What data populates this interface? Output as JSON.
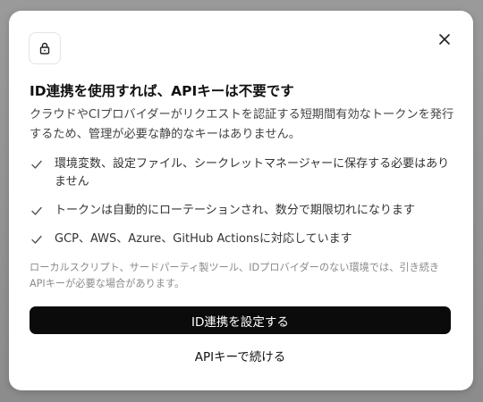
{
  "dialog": {
    "title": "ID連携を使用すれば、APIキーは不要です",
    "description": "クラウドやCIプロバイダーがリクエストを認証する短期間有効なトークンを発行するため、管理が必要な静的なキーはありません。",
    "features": [
      "環境変数、設定ファイル、シークレットマネージャーに保存する必要はありません",
      "トークンは自動的にローテーションされ、数分で期限切れになります",
      "GCP、AWS、Azure、GitHub Actionsに対応しています"
    ],
    "note": "ローカルスクリプト、サードパーティ製ツール、IDプロバイダーのない環境では、引き続きAPIキーが必要な場合があります。",
    "primary_button": "ID連携を設定する",
    "secondary_button": "APIキーで続ける"
  },
  "icons": {
    "header": "lock-icon",
    "close": "close-icon",
    "bullet": "check-icon"
  },
  "colors": {
    "primary_button_bg": "#0b0b0b",
    "primary_button_text": "#ffffff",
    "backdrop": "#8f8f8f"
  }
}
